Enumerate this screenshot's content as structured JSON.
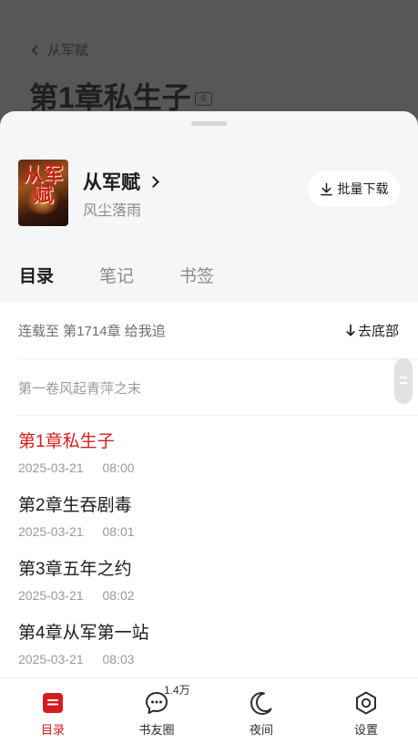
{
  "background": {
    "back_label": "从军赋",
    "chapter_title": "第1章私生子",
    "badge": "6"
  },
  "book": {
    "cover_text": "从军赋",
    "title": "从军赋",
    "author": "风尘落雨",
    "download_label": "批量下载"
  },
  "tabs": [
    {
      "label": "目录",
      "active": true
    },
    {
      "label": "笔记",
      "active": false
    },
    {
      "label": "书签",
      "active": false
    }
  ],
  "catalog": {
    "serial_status": "连载至 第1714章 给我追",
    "to_bottom_label": "去底部",
    "volume": "第一卷风起青萍之末",
    "chapters": [
      {
        "title": "第1章私生子",
        "date": "2025-03-21",
        "time": "08:00",
        "current": true
      },
      {
        "title": "第2章生吞剧毒",
        "date": "2025-03-21",
        "time": "08:01",
        "current": false
      },
      {
        "title": "第3章五年之约",
        "date": "2025-03-21",
        "time": "08:02",
        "current": false
      },
      {
        "title": "第4章从军第一站",
        "date": "2025-03-21",
        "time": "08:03",
        "current": false
      }
    ]
  },
  "nav": {
    "items": [
      {
        "label": "目录",
        "icon": "catalog-icon",
        "active": true
      },
      {
        "label": "书友圈",
        "icon": "chat-bubble-icon",
        "badge": "1.4万"
      },
      {
        "label": "夜间",
        "icon": "moon-icon"
      },
      {
        "label": "设置",
        "icon": "settings-icon"
      }
    ]
  },
  "colors": {
    "accent": "#d41d1d",
    "overlay": "#575757",
    "sheet_bg": "#f5f6f8"
  }
}
